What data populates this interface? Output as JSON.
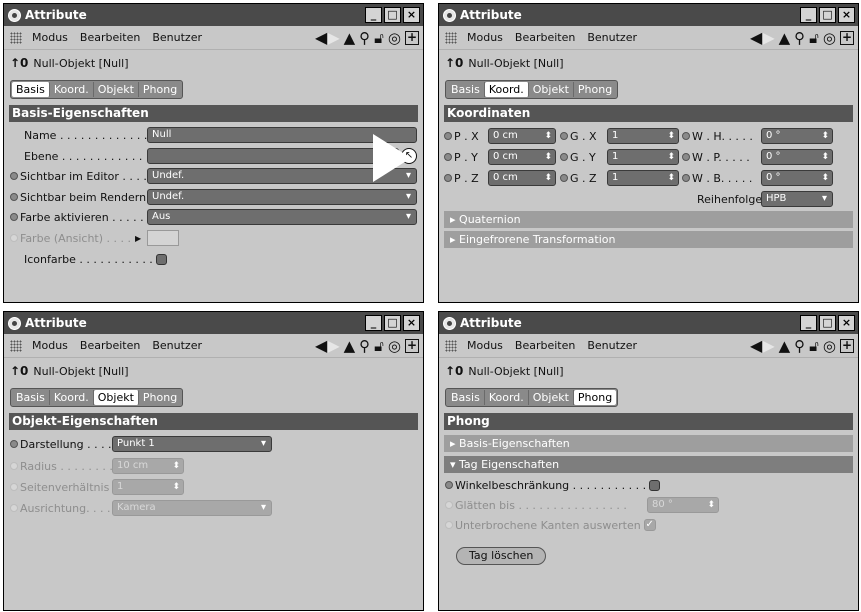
{
  "common": {
    "window_title": "Attribute",
    "menu": [
      "Modus",
      "Bearbeiten",
      "Benutzer"
    ],
    "object_label": "Null-Objekt [Null]",
    "tabs": [
      "Basis",
      "Koord.",
      "Objekt",
      "Phong"
    ],
    "window_buttons": [
      "_",
      "□",
      "×"
    ]
  },
  "panel1": {
    "section": "Basis-Eigenschaften",
    "active_tab": "Basis",
    "rows": {
      "name": {
        "label": "Name . . . . . . . . . . . . . . .",
        "value": "Null"
      },
      "ebene": {
        "label": "Ebene . . . . . . . . . . . . . .",
        "value": ""
      },
      "editor": {
        "label": "Sichtbar im Editor . . . . .",
        "value": "Undef."
      },
      "render": {
        "label": "Sichtbar beim Rendern",
        "value": "Undef."
      },
      "farbe_akt": {
        "label": "Farbe aktivieren . . . . . .",
        "value": "Aus"
      },
      "farbe_ans": {
        "label": "Farbe (Ansicht) . . . .",
        "value": ""
      },
      "iconfarbe": {
        "label": "Iconfarbe . . . . . . . . . . .",
        "value": false
      }
    }
  },
  "panel2": {
    "section": "Koordinaten",
    "active_tab": "Koord.",
    "coords": [
      {
        "p_label": "P . X",
        "p_value": "0 cm",
        "g_label": "G . X",
        "g_value": "1",
        "w_label": "W . H. . . . .",
        "w_value": "0 °"
      },
      {
        "p_label": "P . Y",
        "p_value": "0 cm",
        "g_label": "G . Y",
        "g_value": "1",
        "w_label": "W . P. . . . .",
        "w_value": "0 °"
      },
      {
        "p_label": "P . Z",
        "p_value": "0 cm",
        "g_label": "G . Z",
        "g_value": "1",
        "w_label": "W . B. . . . .",
        "w_value": "0 °"
      }
    ],
    "order_label": "Reihenfolge",
    "order_value": "HPB",
    "folds": [
      "Quaternion",
      "Eingefrorene Transformation"
    ]
  },
  "panel3": {
    "section": "Objekt-Eigenschaften",
    "active_tab": "Objekt",
    "rows": {
      "darstellung": {
        "label": "Darstellung . . . .",
        "value": "Punkt 1"
      },
      "radius": {
        "label": "Radius . . . . . . . .",
        "value": "10 cm"
      },
      "seiten": {
        "label": "Seitenverhältnis",
        "value": "1"
      },
      "ausrichtung": {
        "label": "Ausrichtung. . . .",
        "value": "Kamera"
      }
    }
  },
  "panel4": {
    "section": "Phong",
    "active_tab": "Phong",
    "folds": [
      "Basis-Eigenschaften",
      "Tag Eigenschaften"
    ],
    "rows": {
      "winkel": {
        "label": "Winkelbeschränkung . . . . . . . . . . .",
        "value": false
      },
      "glaetten": {
        "label": "Glätten bis . . . . . . . . . . . . . . . .",
        "value": "80 °"
      },
      "kanten": {
        "label": "Unterbrochene Kanten auswerten",
        "value": true
      }
    },
    "delete_button": "Tag löschen"
  },
  "colors": {
    "titlebar": "#4a4a4a",
    "panel_bg": "#c8c8c8",
    "section_bg": "#555555",
    "field_bg": "#6e6e6e"
  }
}
